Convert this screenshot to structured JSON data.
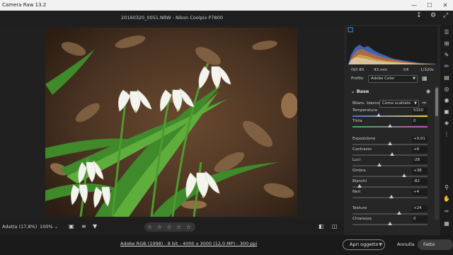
{
  "app": {
    "title": "Camera Raw 13.2"
  },
  "document": {
    "header": "20160320_0051.NRW  -  Nikon Coolpix P7800"
  },
  "bottom_bar": {
    "fit_label": "Adatta (17,8%)",
    "zoom_value": "100%",
    "rating": "☆ ☆ ☆ ☆ ☆"
  },
  "footer": {
    "info": "Adobe RGB (1998) - 8 bit - 4000 x 3000 (12,0 MP) - 300 ppi",
    "open_button": "Apri oggetto",
    "cancel_button": "Annulla",
    "done_button": "Fatto"
  },
  "exif": {
    "iso": "ISO 80",
    "focal": "43 mm",
    "aperture": "f/4",
    "shutter": "1/320s"
  },
  "profile": {
    "label": "Profilo",
    "value": "Adobe Color"
  },
  "base_section": {
    "title": "Base",
    "wb_label": "Bilanc. bianco",
    "wb_value": "Come scattato",
    "sliders": [
      {
        "label": "Temperatura",
        "value": "5150",
        "level": 0.35
      },
      {
        "label": "Tinta",
        "value": "0",
        "level": 0.5
      },
      {
        "label": "Esposizione",
        "value": "+0,01",
        "level": 0.5
      },
      {
        "label": "Contrasto",
        "value": "+6",
        "level": 0.53
      },
      {
        "label": "Luci",
        "value": "-28",
        "level": 0.36
      },
      {
        "label": "Ombre",
        "value": "+38",
        "level": 0.69
      },
      {
        "label": "Bianchi",
        "value": "-82",
        "level": 0.09
      },
      {
        "label": "Neri",
        "value": "+4",
        "level": 0.52
      },
      {
        "label": "Texture",
        "value": "+24",
        "level": 0.62
      },
      {
        "label": "Chiarezza",
        "value": "0",
        "level": 0.5
      }
    ]
  },
  "icons": {
    "accent": "#3d8fe8"
  }
}
